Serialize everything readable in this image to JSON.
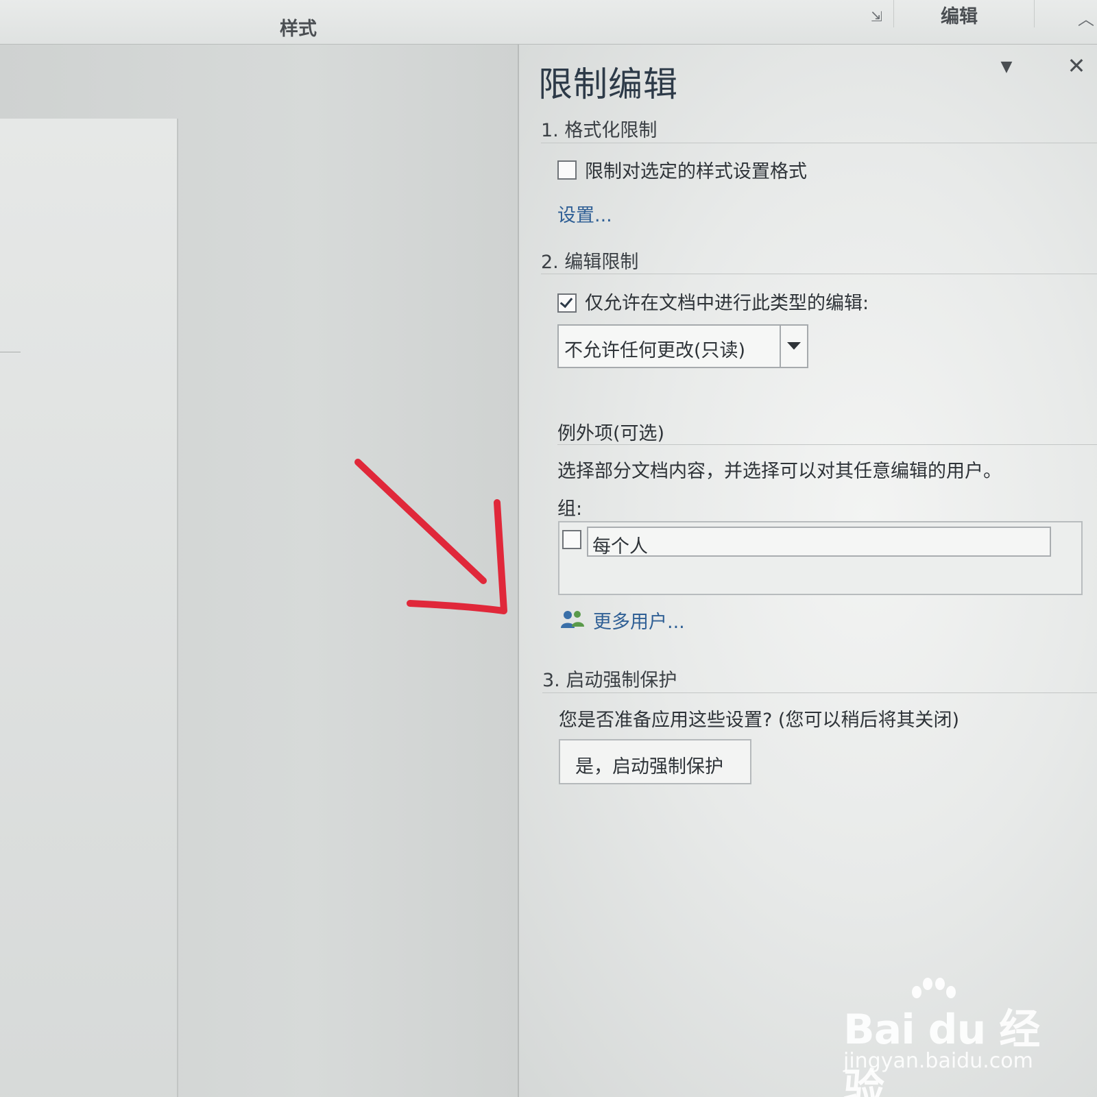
{
  "ribbon": {
    "styles_group": "样式",
    "editing_group": "编辑",
    "launcher_icon": "dialog-launcher-icon",
    "collapse_icon": "chevron-up-icon"
  },
  "pane": {
    "title": "限制编辑",
    "options_icon": "triangle-down-icon",
    "close_icon": "close-icon",
    "section1": {
      "heading": "1. 格式化限制",
      "checkbox_label": "限制对选定的样式设置格式",
      "checked": false,
      "settings_link": "设置..."
    },
    "section2": {
      "heading": "2. 编辑限制",
      "checkbox_label": "仅允许在文档中进行此类型的编辑:",
      "checked": true,
      "dropdown_value": "不允许任何更改(只读)",
      "exceptions_heading": "例外项(可选)",
      "exceptions_desc": "选择部分文档内容，并选择可以对其任意编辑的用户。",
      "groups_label": "组:",
      "groups": [
        {
          "name": "每个人",
          "checked": false
        }
      ],
      "more_users_link": "更多用户..."
    },
    "section3": {
      "heading": "3. 启动强制保护",
      "question": "您是否准备应用这些设置? (您可以稍后将其关闭)",
      "start_button": "是，启动强制保护"
    }
  },
  "annotation": {
    "color": "#e0283a"
  },
  "watermark": {
    "brand": "Bai du 经验",
    "site": "jingyan.baidu.com"
  }
}
